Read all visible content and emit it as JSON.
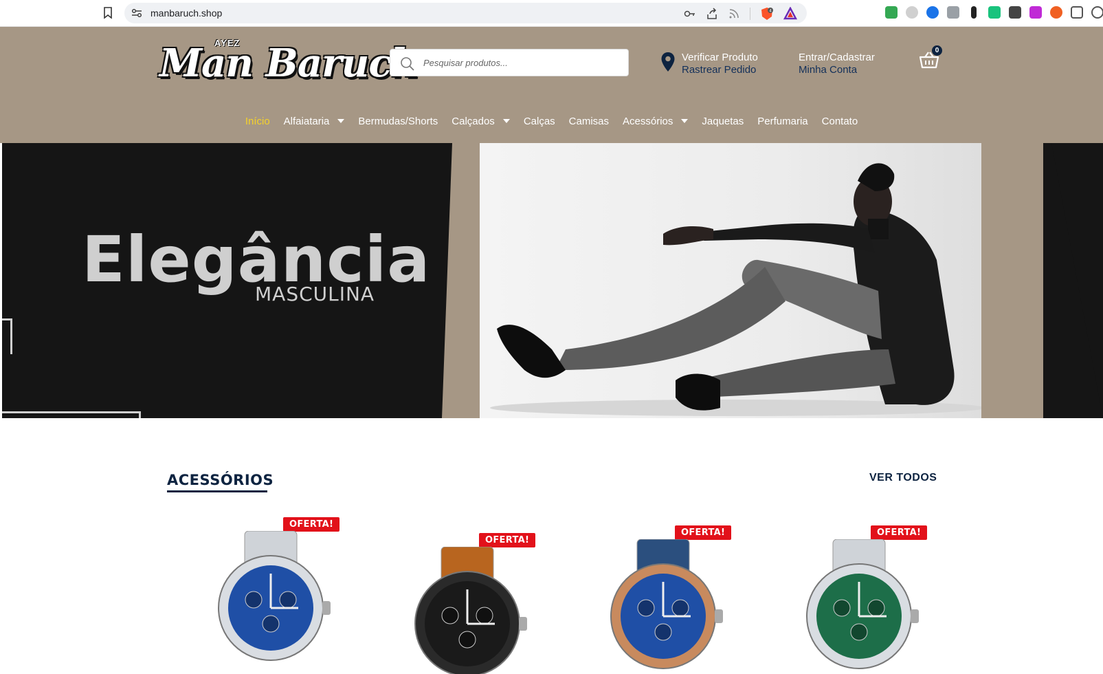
{
  "browser": {
    "url": "manbaruch.shop",
    "icons": [
      "bookmark-icon",
      "site-settings-icon",
      "password-key-icon",
      "share-icon",
      "rss-icon",
      "brave-shield-icon",
      "brave-rewards-icon"
    ],
    "shield_badge": "4"
  },
  "header": {
    "logo_text": "Man Baruch",
    "logo_tag": "AYEZ",
    "search_placeholder": "Pesquisar produtos...",
    "track": {
      "line1": "Verificar Produto",
      "line2": "Rastrear Pedido"
    },
    "account": {
      "line1": "Entrar/Cadastrar",
      "line2": "Minha Conta"
    },
    "cart_count": "0"
  },
  "nav": {
    "items": [
      {
        "label": "Início",
        "active": true,
        "dropdown": false
      },
      {
        "label": "Alfaiataria",
        "active": false,
        "dropdown": true
      },
      {
        "label": "Bermudas/Shorts",
        "active": false,
        "dropdown": false
      },
      {
        "label": "Calçados",
        "active": false,
        "dropdown": true
      },
      {
        "label": "Calças",
        "active": false,
        "dropdown": false
      },
      {
        "label": "Camisas",
        "active": false,
        "dropdown": false
      },
      {
        "label": "Acessórios",
        "active": false,
        "dropdown": true
      },
      {
        "label": "Jaquetas",
        "active": false,
        "dropdown": false
      },
      {
        "label": "Perfumaria",
        "active": false,
        "dropdown": false
      },
      {
        "label": "Contato",
        "active": false,
        "dropdown": false
      }
    ]
  },
  "banner": {
    "headline": "Elegância",
    "subline": "MASCULINA",
    "slides": 3,
    "active_slide": 1
  },
  "section": {
    "title": "ACESSÓRIOS",
    "see_all": "VER TODOS",
    "products": [
      {
        "badge": "OFERTA!",
        "dial": "blue",
        "strap": "steel"
      },
      {
        "badge": "OFERTA!",
        "dial": "black",
        "strap": "leather-brown"
      },
      {
        "badge": "OFERTA!",
        "dial": "blue",
        "strap": "leather-blue"
      },
      {
        "badge": "OFERTA!",
        "dial": "green",
        "strap": "steel"
      }
    ]
  },
  "colors": {
    "header_bg": "#a69785",
    "navy": "#0d2340",
    "active_nav": "#f5d22a",
    "offer_red": "#e2111a"
  }
}
